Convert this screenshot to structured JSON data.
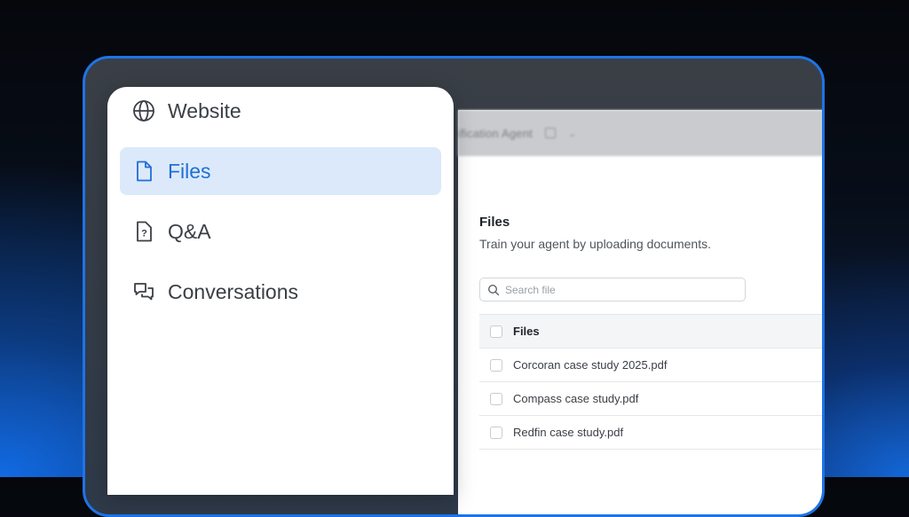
{
  "sidebar": {
    "items": [
      {
        "label": "Website",
        "icon": "globe-icon",
        "active": false
      },
      {
        "label": "Files",
        "icon": "file-icon",
        "active": true
      },
      {
        "label": "Q&A",
        "icon": "question-doc-icon",
        "active": false
      },
      {
        "label": "Conversations",
        "icon": "chat-bubbles-icon",
        "active": false
      }
    ]
  },
  "app": {
    "agent_name": "ification Agent"
  },
  "main": {
    "title": "Files",
    "subtitle": "Train your agent by uploading documents.",
    "search": {
      "placeholder": "Search file"
    },
    "table": {
      "header": "Files",
      "rows": [
        "Corcoran case study 2025.pdf",
        "Compass case study.pdf",
        "Redfin case study.pdf"
      ]
    }
  },
  "colors": {
    "accent": "#1f6fd6",
    "active_bg": "#dce9fb",
    "frame_border": "#1d74e8"
  }
}
